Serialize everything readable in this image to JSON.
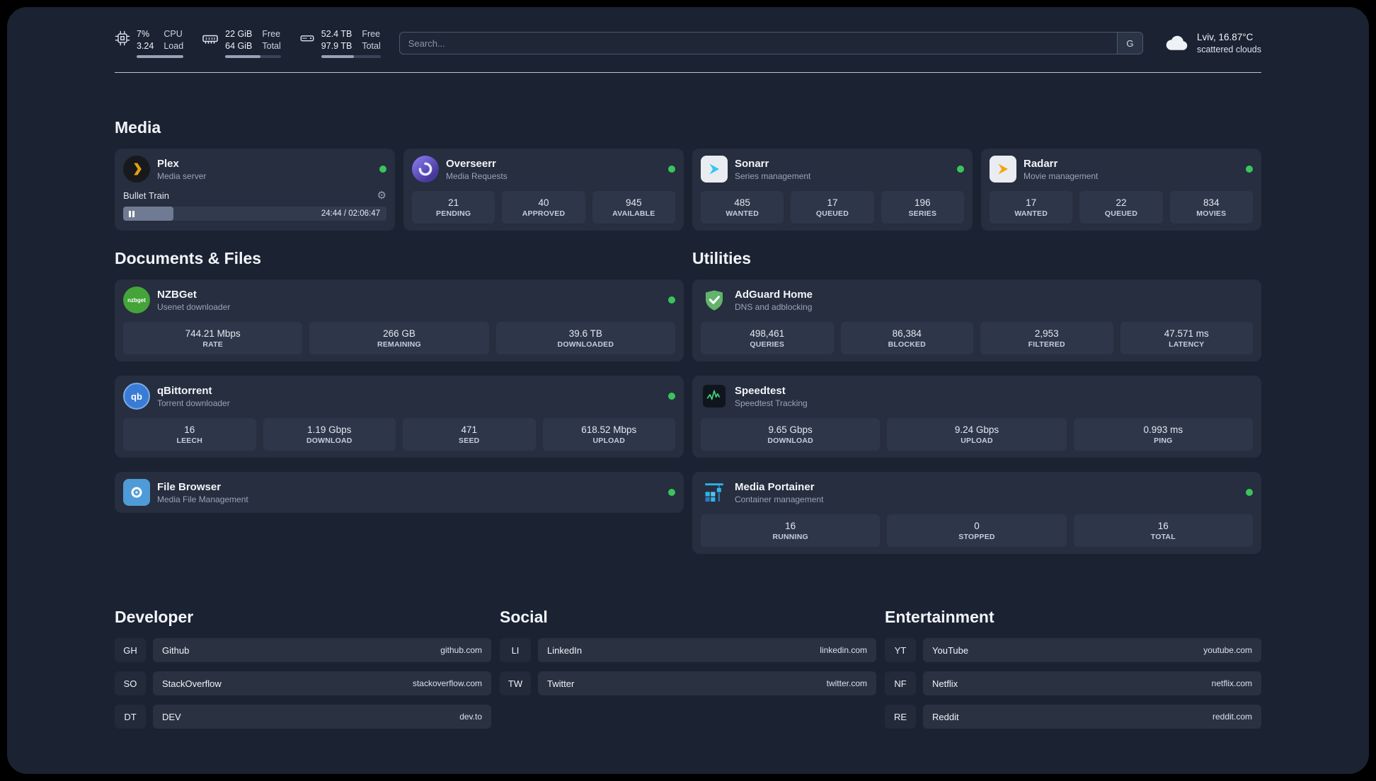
{
  "colors": {
    "status_online": "#3bc45e",
    "page_bg": "#1b2232",
    "card_bg": "#262e3f",
    "plex_amber": "#e5a00d",
    "overseerr_purple": "#5f4bc2",
    "sonarr_blue": "#35c5f4",
    "radarr_yellow": "#f2a60d",
    "nzbget_green": "#44a339",
    "qbittorrent_blue": "#3a7bd5",
    "adguard_green": "#62b36b",
    "portainer_blue": "#2fb4e9"
  },
  "topbar": {
    "cpu": {
      "value_top": "7%",
      "value_bottom": "3.24",
      "label_top": "CPU",
      "label_bottom": "Load",
      "progress": 100
    },
    "ram": {
      "value_top": "22 GiB",
      "value_bottom": "64 GiB",
      "label_top": "Free",
      "label_bottom": "Total",
      "progress": 63
    },
    "disk": {
      "value_top": "52.4 TB",
      "value_bottom": "97.9 TB",
      "label_top": "Free",
      "label_bottom": "Total",
      "progress": 55
    },
    "search": {
      "placeholder": "Search...",
      "button_label": "G"
    },
    "weather": {
      "location": "Lviv, 16.87°C",
      "condition": "scattered clouds"
    }
  },
  "media": {
    "section_title": "Media",
    "plex": {
      "title": "Plex",
      "subtitle": "Media server",
      "now_playing": "Bullet Train",
      "time": "24:44 / 02:06:47",
      "progress": 19
    },
    "overseerr": {
      "title": "Overseerr",
      "subtitle": "Media Requests",
      "stats": [
        {
          "value": "21",
          "label": "PENDING"
        },
        {
          "value": "40",
          "label": "APPROVED"
        },
        {
          "value": "945",
          "label": "AVAILABLE"
        }
      ]
    },
    "sonarr": {
      "title": "Sonarr",
      "subtitle": "Series management",
      "stats": [
        {
          "value": "485",
          "label": "WANTED"
        },
        {
          "value": "17",
          "label": "QUEUED"
        },
        {
          "value": "196",
          "label": "SERIES"
        }
      ]
    },
    "radarr": {
      "title": "Radarr",
      "subtitle": "Movie management",
      "stats": [
        {
          "value": "17",
          "label": "WANTED"
        },
        {
          "value": "22",
          "label": "QUEUED"
        },
        {
          "value": "834",
          "label": "MOVIES"
        }
      ]
    }
  },
  "documents": {
    "section_title": "Documents & Files",
    "nzbget": {
      "title": "NZBGet",
      "subtitle": "Usenet downloader",
      "icon_text": "nzbget",
      "stats": [
        {
          "value": "744.21 Mbps",
          "label": "RATE"
        },
        {
          "value": "266 GB",
          "label": "REMAINING"
        },
        {
          "value": "39.6 TB",
          "label": "DOWNLOADED"
        }
      ]
    },
    "qbittorrent": {
      "title": "qBittorrent",
      "subtitle": "Torrent downloader",
      "icon_text": "qb",
      "stats": [
        {
          "value": "16",
          "label": "LEECH"
        },
        {
          "value": "1.19 Gbps",
          "label": "DOWNLOAD"
        },
        {
          "value": "471",
          "label": "SEED"
        },
        {
          "value": "618.52 Mbps",
          "label": "UPLOAD"
        }
      ]
    },
    "filebrowser": {
      "title": "File Browser",
      "subtitle": "Media File Management"
    }
  },
  "utilities": {
    "section_title": "Utilities",
    "adguard": {
      "title": "AdGuard Home",
      "subtitle": "DNS and adblocking",
      "stats": [
        {
          "value": "498,461",
          "label": "QUERIES"
        },
        {
          "value": "86,384",
          "label": "BLOCKED"
        },
        {
          "value": "2,953",
          "label": "FILTERED"
        },
        {
          "value": "47.571 ms",
          "label": "LATENCY"
        }
      ]
    },
    "speedtest": {
      "title": "Speedtest",
      "subtitle": "Speedtest Tracking",
      "stats": [
        {
          "value": "9.65 Gbps",
          "label": "DOWNLOAD"
        },
        {
          "value": "9.24 Gbps",
          "label": "UPLOAD"
        },
        {
          "value": "0.993 ms",
          "label": "PING"
        }
      ]
    },
    "portainer": {
      "title": "Media Portainer",
      "subtitle": "Container management",
      "stats": [
        {
          "value": "16",
          "label": "RUNNING"
        },
        {
          "value": "0",
          "label": "STOPPED"
        },
        {
          "value": "16",
          "label": "TOTAL"
        }
      ]
    }
  },
  "bookmarks": {
    "developer": {
      "section_title": "Developer",
      "items": [
        {
          "abbr": "GH",
          "name": "Github",
          "url": "github.com"
        },
        {
          "abbr": "SO",
          "name": "StackOverflow",
          "url": "stackoverflow.com"
        },
        {
          "abbr": "DT",
          "name": "DEV",
          "url": "dev.to"
        }
      ]
    },
    "social": {
      "section_title": "Social",
      "items": [
        {
          "abbr": "LI",
          "name": "LinkedIn",
          "url": "linkedin.com"
        },
        {
          "abbr": "TW",
          "name": "Twitter",
          "url": "twitter.com"
        }
      ]
    },
    "entertainment": {
      "section_title": "Entertainment",
      "items": [
        {
          "abbr": "YT",
          "name": "YouTube",
          "url": "youtube.com"
        },
        {
          "abbr": "NF",
          "name": "Netflix",
          "url": "netflix.com"
        },
        {
          "abbr": "RE",
          "name": "Reddit",
          "url": "reddit.com"
        }
      ]
    }
  }
}
